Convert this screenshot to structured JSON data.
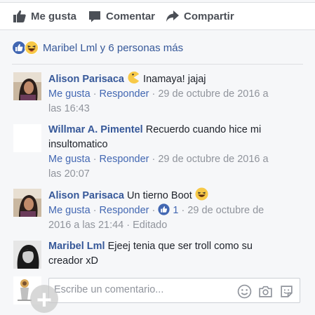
{
  "actions": {
    "like": "Me gusta",
    "comment": "Comentar",
    "share": "Compartir"
  },
  "reactions": {
    "summary": "Maribel Lml y 6 personas más",
    "types": [
      "like-icon",
      "haha-icon"
    ]
  },
  "comments": [
    {
      "author": "Alison Parisaca",
      "text": " Inamaya! jajaj",
      "emoji": "pacman-icon",
      "like_label": "Me gusta",
      "reply_label": "Responder",
      "timestamp_line1": "· 29 de octubre de 2016 a",
      "timestamp_line2": "las 16:43"
    },
    {
      "author": "Willmar A. Pimentel",
      "text_line1": " Recuerdo cuando hice mi",
      "text_line2": "insultomatico",
      "like_label": "Me gusta",
      "reply_label": "Responder",
      "timestamp_line1": "· 29 de octubre de 2016 a",
      "timestamp_line2": "las 20:07"
    },
    {
      "author": "Alison Parisaca",
      "text": " Un tierno Boot ",
      "emoji": "laughing-face-icon",
      "like_label": "Me gusta",
      "reply_label": "Responder",
      "like_count": "1",
      "timestamp_line1": "· 29 de octubre de",
      "timestamp_line2": "2016 a las 21:44 · Editado"
    },
    {
      "author": "Maribel Lml",
      "text_line1": " Ejeej tenia que ser troll como su",
      "text_line2": "creador xD"
    }
  ],
  "composer": {
    "placeholder": "Escribe un comentario...",
    "icons": [
      "emoji-icon",
      "camera-icon",
      "sticker-icon"
    ]
  },
  "colors": {
    "link": "#365899",
    "meta": "#90949c",
    "like_blue": "#4267b2",
    "actions_grey": "#4b4f56"
  }
}
